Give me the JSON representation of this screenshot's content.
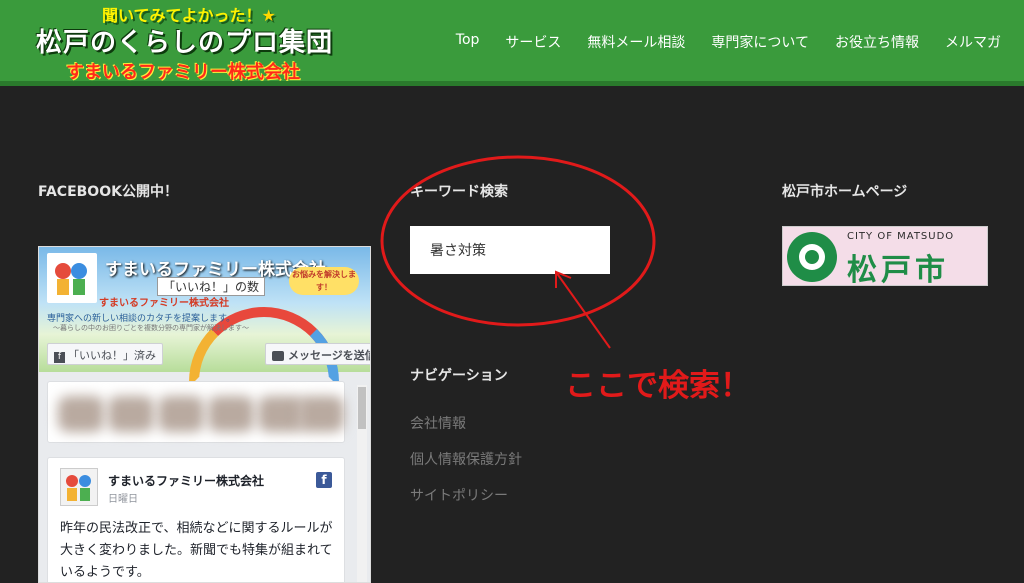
{
  "header": {
    "logo_tag": "聞いてみてよかった！",
    "logo_star": "★",
    "logo_main": "松戸のくらしのプロ集団",
    "logo_sub": "すまいるファミリー株式会社",
    "nav": [
      "Top",
      "サービス",
      "無料メール相談",
      "専門家について",
      "お役立ち情報",
      "メルマガ"
    ]
  },
  "facebook": {
    "title": "FACEBOOK公開中！",
    "page_name": "すまいるファミリー株式会社",
    "likes_label": "「いいね！」の数",
    "company_small": "すまいるファミリー株式会社",
    "tagline": "専門家への新しい相談のカタチを提案します。",
    "subtagline": "〜暮らしの中のお困りごとを複数分野の専門家が解決します〜",
    "bubble": "お悩みを解決します！",
    "like_button": "「いいね！」済み",
    "message_button": "メッセージを送信",
    "post": {
      "name": "すまいるファミリー株式会社",
      "date": "日曜日",
      "text": "昨年の民法改正で、相続などに関するルールが大きく変わりました。新聞でも特集が組まれているようです。"
    }
  },
  "search": {
    "title": "キーワード検索",
    "value": "暑さ対策"
  },
  "navigation": {
    "title": "ナビゲーション",
    "links": [
      "会社情報",
      "個人情報保護方針",
      "サイトポリシー"
    ]
  },
  "matsudo": {
    "title": "松戸市ホームページ",
    "en": "CITY OF MATSUDO",
    "jp": "松戸市"
  },
  "annotation": {
    "text": "ここで検索！",
    "color": "#e11a1a"
  },
  "colors": {
    "header_bg": "#3a9b3c",
    "page_bg": "#222222",
    "link": "#7a7a7a"
  }
}
